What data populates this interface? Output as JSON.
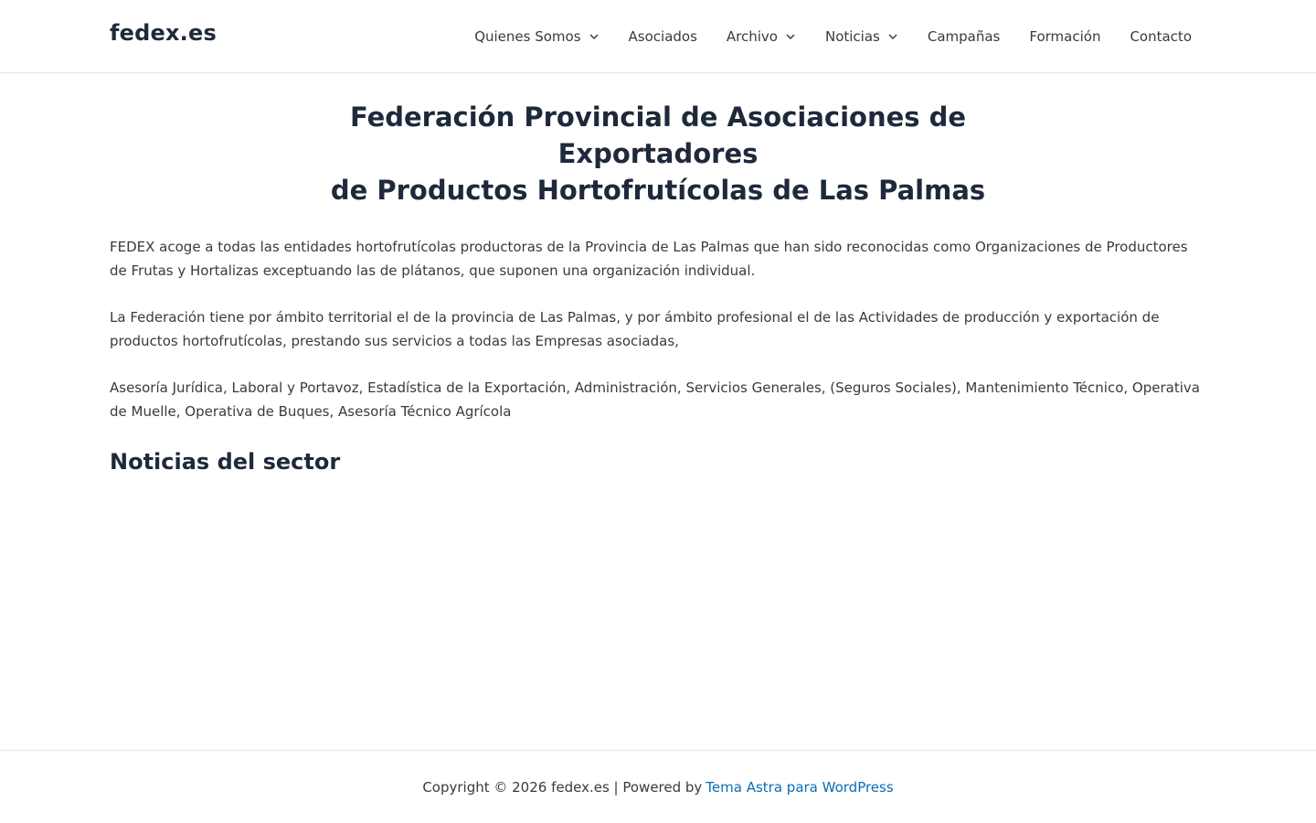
{
  "header": {
    "brand": "fedex.es",
    "nav": [
      {
        "label": "Quienes Somos",
        "has_dropdown": true
      },
      {
        "label": "Asociados",
        "has_dropdown": false
      },
      {
        "label": "Archivo",
        "has_dropdown": true
      },
      {
        "label": "Noticias",
        "has_dropdown": true
      },
      {
        "label": "Campañas",
        "has_dropdown": false
      },
      {
        "label": "Formación",
        "has_dropdown": false
      },
      {
        "label": "Contacto",
        "has_dropdown": false
      }
    ]
  },
  "main": {
    "title_line1": "Federación Provincial de Asociaciones de Exportadores",
    "title_line2": "de Productos Hortofrutícolas de Las Palmas",
    "paragraphs": [
      "FEDEX acoge a todas las entidades hortofrutícolas  productoras de la Provincia de Las Palmas que han sido reconocidas como Organizaciones de Productores de Frutas y Hortalizas exceptuando las de plátanos, que suponen una organización individual.",
      "La Federación tiene por ámbito territorial el de la provincia de Las Palmas, y por ámbito profesional el de las Actividades de producción y exportación de productos hortofrutícolas, prestando sus servicios a todas las Empresas asociadas,",
      "Asesoría Jurídica, Laboral y Portavoz, Estadística de la Exportación, Administración, Servicios Generales, (Seguros Sociales), Mantenimiento Técnico, Operativa de Muelle, Operativa de Buques, Asesoría Técnico Agrícola"
    ],
    "section_heading": "Noticias del sector"
  },
  "footer": {
    "copyright": "Copyright © 2026 fedex.es | Powered by",
    "link_label": "Tema Astra para WordPress"
  },
  "colors": {
    "heading": "#1e293b",
    "text": "#3a3a3a",
    "link": "#0c6eb5",
    "border": "#e5e7eb"
  },
  "icons": {
    "dropdown": "chevron-down-icon"
  }
}
